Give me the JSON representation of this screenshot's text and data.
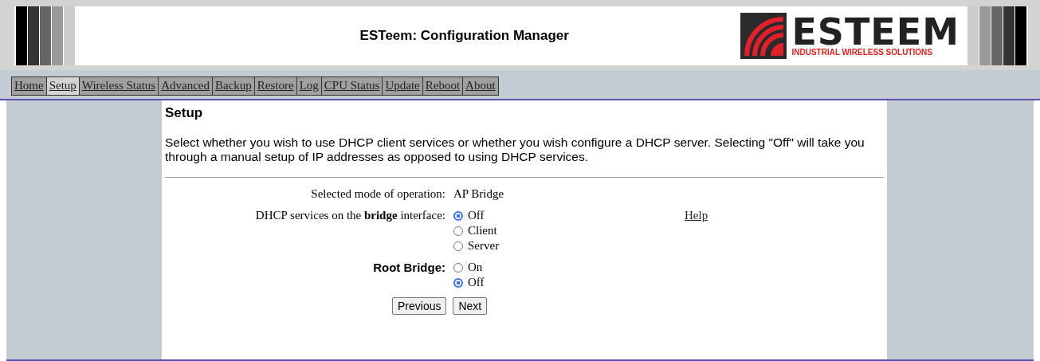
{
  "window": {
    "title": "ESTeem: Configuration Manager"
  },
  "logo": {
    "name": "ESTEEM",
    "tagline": "INDUSTRIAL WIRELESS SOLUTIONS"
  },
  "tabs": [
    {
      "label": "Home",
      "selected": false
    },
    {
      "label": "Setup",
      "selected": true
    },
    {
      "label": "Wireless Status",
      "selected": false
    },
    {
      "label": "Advanced",
      "selected": false
    },
    {
      "label": "Backup",
      "selected": false
    },
    {
      "label": "Restore",
      "selected": false
    },
    {
      "label": "Log",
      "selected": false
    },
    {
      "label": "CPU Status",
      "selected": false
    },
    {
      "label": "Update",
      "selected": false
    },
    {
      "label": "Reboot",
      "selected": false
    },
    {
      "label": "About",
      "selected": false
    }
  ],
  "page": {
    "heading": "Setup",
    "description": "Select whether you wish to use DHCP client services or whether you wish configure a DHCP server. Selecting \"Off\" will take you through a manual setup of IP addresses as opposed to using DHCP services.",
    "mode_label": "Selected mode of operation:",
    "mode_value": "AP Bridge",
    "dhcp": {
      "label": "DHCP services on the **bridge** interface:",
      "options": [
        {
          "label": "Off",
          "selected": true
        },
        {
          "label": "Client",
          "selected": false
        },
        {
          "label": "Server",
          "selected": false
        }
      ]
    },
    "help_link": "Help",
    "root_bridge": {
      "label": "Root Bridge:",
      "options": [
        {
          "label": "On",
          "selected": false
        },
        {
          "label": "Off",
          "selected": true
        }
      ]
    },
    "buttons": [
      "Previous",
      "Next"
    ]
  }
}
